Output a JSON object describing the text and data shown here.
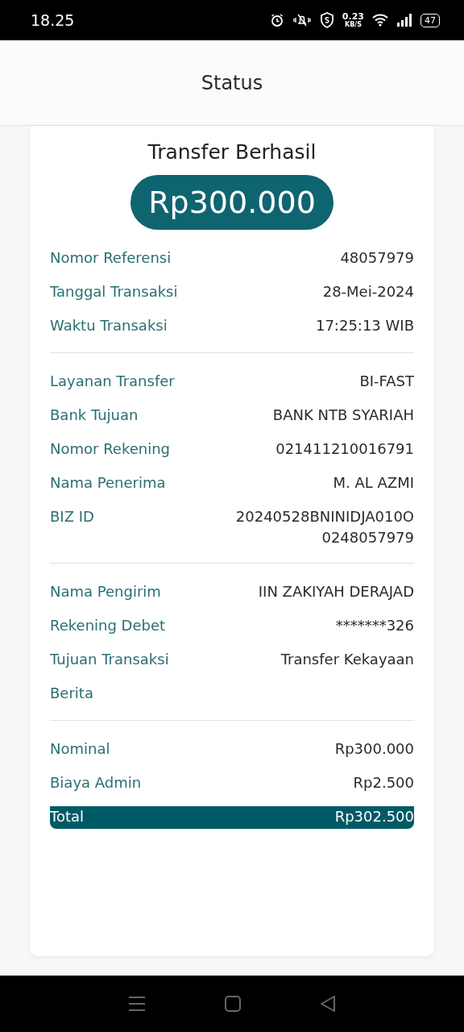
{
  "status_bar": {
    "time": "18.25",
    "net_speed": "0.23",
    "net_unit": "KB/S",
    "battery": "47"
  },
  "header": {
    "title": "Status"
  },
  "receipt": {
    "title": "Transfer Berhasil",
    "amount": "Rp300.000",
    "sections": [
      {
        "rows": [
          {
            "kind": "plain",
            "label": "Nomor Referensi",
            "value": "48057979"
          },
          {
            "kind": "plain",
            "label": "Tanggal Transaksi",
            "value": "28-Mei-2024"
          },
          {
            "kind": "plain",
            "label": "Waktu Transaksi",
            "value": "17:25:13 WIB"
          }
        ]
      },
      {
        "rows": [
          {
            "kind": "plain",
            "label": "Layanan Transfer",
            "value": "BI-FAST"
          },
          {
            "kind": "plain",
            "label": "Bank Tujuan",
            "value": "BANK NTB SYARIAH"
          },
          {
            "kind": "plain",
            "label": "Nomor Rekening",
            "value": "021411210016791"
          },
          {
            "kind": "plain",
            "label": "Nama Penerima",
            "value": "M. AL AZMI"
          },
          {
            "kind": "plain",
            "label": "BIZ ID",
            "value": "20240528BNINIDJA010O\n0248057979"
          }
        ]
      },
      {
        "rows": [
          {
            "kind": "plain",
            "label": "Nama Pengirim",
            "value": "IIN ZAKIYAH DERAJAD"
          },
          {
            "kind": "plain",
            "label": "Rekening Debet",
            "value": "*******326"
          },
          {
            "kind": "plain",
            "label": "Tujuan Transaksi",
            "value": "Transfer Kekayaan"
          },
          {
            "kind": "plain",
            "label": "Berita"
          }
        ]
      },
      {
        "rows": [
          {
            "kind": "plain",
            "label": "Nominal",
            "value": "Rp300.000"
          },
          {
            "kind": "plain",
            "label": "Biaya Admin",
            "value": "Rp2.500"
          },
          {
            "kind": "total",
            "label": "Total",
            "value": "Rp302.500"
          }
        ]
      }
    ]
  }
}
